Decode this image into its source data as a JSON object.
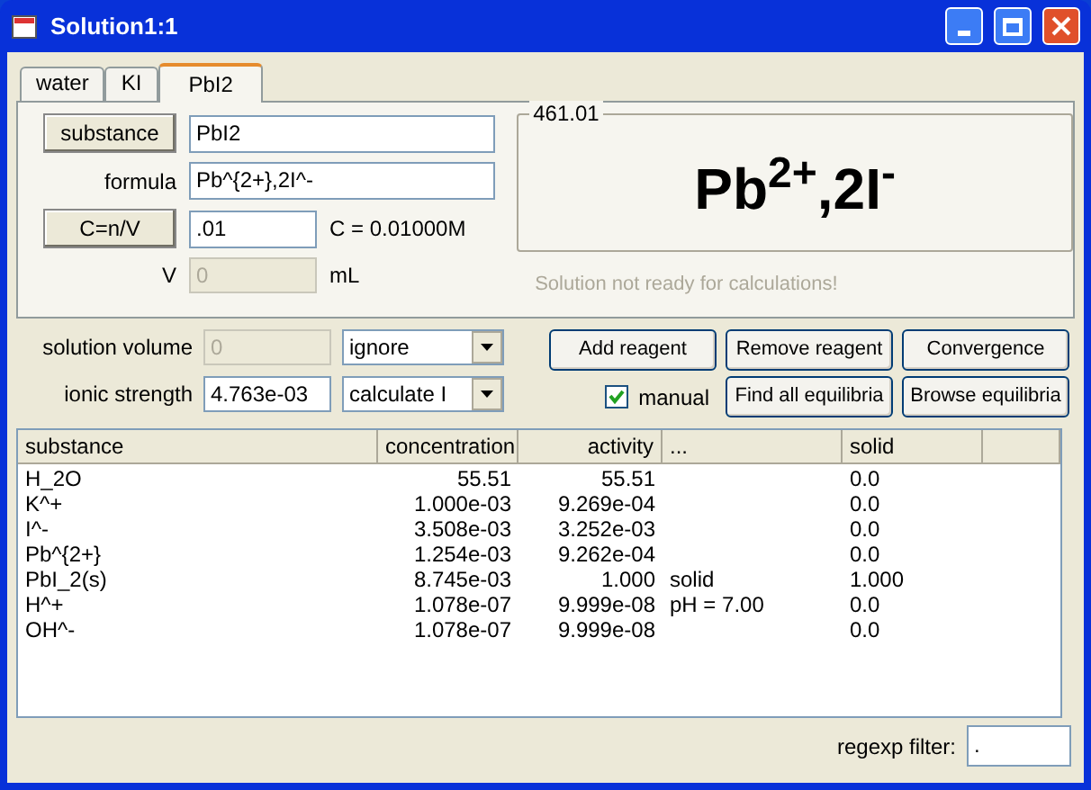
{
  "window": {
    "title": "Solution1:1"
  },
  "tabs": [
    {
      "label": "water",
      "selected": false
    },
    {
      "label": "KI",
      "selected": false
    },
    {
      "label": "PbI2",
      "selected": true
    }
  ],
  "substance": {
    "button": "substance",
    "value": "PbI2"
  },
  "formula": {
    "label": "formula",
    "value": "Pb^{2+},2I^-"
  },
  "concentration": {
    "button": "C=n/V",
    "value": ".01",
    "result": "C = 0.01000M"
  },
  "volume": {
    "label": "V",
    "value": "0",
    "unit": "mL",
    "disabled": true
  },
  "preview": {
    "title": "461.01",
    "formula": "Pb$^{2+}$,2I$^{-}$",
    "status": "Solution not ready for calculations!"
  },
  "solution_volume": {
    "label": "solution volume",
    "value": "0",
    "disabled": true,
    "mode": "ignore"
  },
  "ionic_strength": {
    "label": "ionic strength",
    "value": "4.763e-03",
    "disabled": false,
    "mode": "calculate I"
  },
  "buttons": [
    "Add reagent",
    "Remove reagent",
    "Convergence"
  ],
  "manual": {
    "label": "manual",
    "checked": true
  },
  "buttons_2": [
    "Find all equilibria",
    "Browse equilibria"
  ],
  "table": {
    "columns": [
      "substance",
      "concentration",
      "activity",
      "...",
      "solid"
    ],
    "rows": [
      [
        "H_2O",
        "55.51",
        "55.51",
        "",
        "0.0"
      ],
      [
        "K^+",
        "1.000e-03",
        "9.269e-04",
        "",
        "0.0"
      ],
      [
        "I^-",
        "3.508e-03",
        "3.252e-03",
        "",
        "0.0"
      ],
      [
        "Pb^{2+}",
        "1.254e-03",
        "9.262e-04",
        "",
        "0.0"
      ],
      [
        "PbI_2(s)",
        "8.745e-03",
        "1.000",
        "solid",
        "1.000"
      ],
      [
        "H^+",
        "1.078e-07",
        "9.999e-08",
        "pH =  7.00",
        "0.0"
      ],
      [
        "OH^-",
        "1.078e-07",
        "9.999e-08",
        "",
        "0.0"
      ]
    ]
  },
  "filter": {
    "label": "regexp filter:",
    "value": "."
  }
}
